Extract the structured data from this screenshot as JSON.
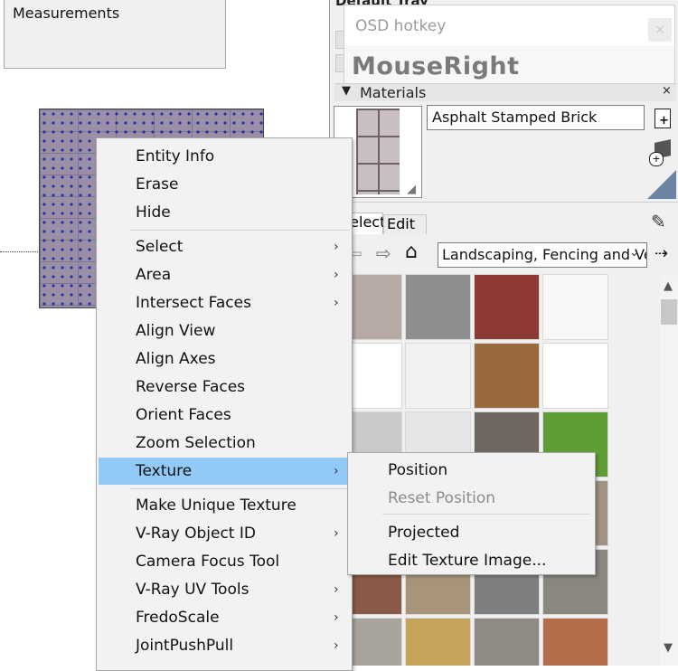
{
  "measurements": {
    "label": "Measurements"
  },
  "tray": {
    "title": "Default Tray"
  },
  "osd": {
    "title": "OSD hotkey",
    "close": "×",
    "key_text": "MouseRight"
  },
  "materials": {
    "header": "Materials",
    "collapse_glyph": "▼",
    "close_glyph": "×",
    "material_name": "Asphalt Stamped Brick",
    "tabs": [
      "Select",
      "Edit"
    ],
    "library": "Landscaping, Fencing and Vegetation",
    "nav_icons": [
      "back-arrow-icon",
      "forward-arrow-icon",
      "home-icon",
      "details-icon"
    ],
    "thumbnails": [
      {
        "color": "#b7a9a3"
      },
      {
        "color": "#8e8e8e"
      },
      {
        "color": "#8e3a34"
      },
      {
        "color": "#f7f7f7"
      },
      {
        "color": "#ffffff"
      },
      {
        "color": "#f2f2f2"
      },
      {
        "color": "#9a6a3f"
      },
      {
        "color": "#ffffff"
      },
      {
        "color": "#c9c9c9"
      },
      {
        "color": "#e6e6e6"
      },
      {
        "color": "#6f6860"
      },
      {
        "color": "#5f9e35"
      },
      {
        "color": "#9c6a55"
      },
      {
        "color": "#8a7563"
      },
      {
        "color": "#7d7975"
      },
      {
        "color": "#a19384"
      },
      {
        "color": "#8a5a48"
      },
      {
        "color": "#a8947a"
      },
      {
        "color": "#7f7f7f"
      },
      {
        "color": "#8a8680"
      },
      {
        "color": "#a8a39b"
      },
      {
        "color": "#c6a35a"
      },
      {
        "color": "#8f8b84"
      },
      {
        "color": "#b56c4b"
      }
    ]
  },
  "context_menu": {
    "groups": [
      [
        "Entity Info",
        "Erase",
        "Hide"
      ],
      [
        "Select",
        "Area",
        "Intersect Faces",
        "Align View",
        "Align Axes",
        "Reverse Faces",
        "Orient Faces",
        "Zoom Selection",
        "Texture"
      ],
      [
        "Make Unique Texture",
        "V-Ray Object ID",
        "Camera Focus Tool",
        "V-Ray UV Tools",
        "FredoScale",
        "JointPushPull"
      ]
    ],
    "highlighted": "Texture",
    "submenu_glyph": "›"
  },
  "texture_submenu": {
    "items": [
      "Position",
      "Reset Position",
      "Projected",
      "Edit Texture Image..."
    ],
    "disabled": [
      "Reset Position"
    ]
  },
  "scroll": {
    "up": "▲",
    "down": "▼"
  }
}
